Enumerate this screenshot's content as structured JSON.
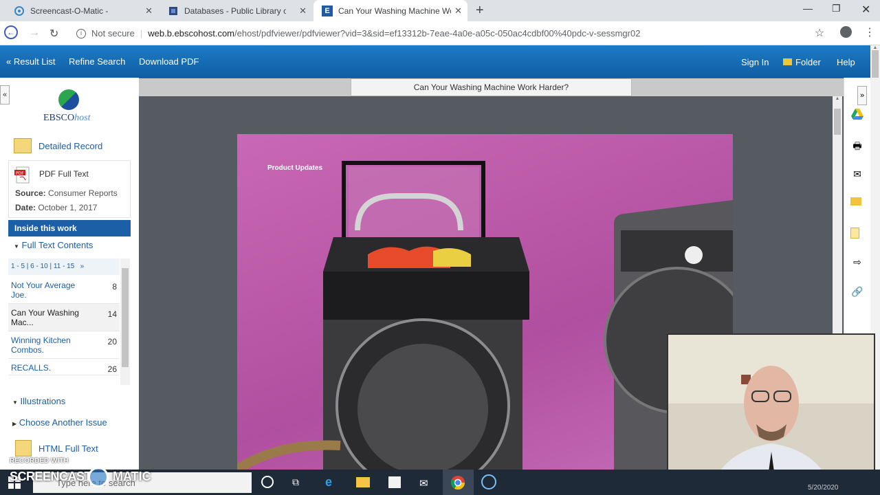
{
  "browser": {
    "tabs": [
      {
        "title": "Screencast-O-Matic -",
        "icon": "screencast-icon"
      },
      {
        "title": "Databases - Public Library of Ste",
        "icon": "library-icon"
      },
      {
        "title": "Can Your Washing Machine Work",
        "icon": "ebsco-e-icon"
      }
    ],
    "not_secure": "Not secure",
    "url_host": "web.b.ebscohost.com",
    "url_path": "/ehost/pdfviewer/pdfviewer?vid=3&sid=ef13312b-7eae-4a0e-a05c-050ac4cdbf00%40pdc-v-sessmgr02"
  },
  "ebsco_nav": {
    "result_list": "« Result List",
    "refine_search": "Refine Search",
    "download_pdf": "Download PDF",
    "sign_in": "Sign In",
    "folder": "Folder",
    "help": "Help"
  },
  "sidebar": {
    "logo_text_a": "EBSCO",
    "logo_text_b": "host",
    "detailed_record": "Detailed Record",
    "pdf_full_text": "PDF Full Text",
    "source_label": "Source:",
    "source_value": "Consumer Reports",
    "date_label": "Date:",
    "date_value": "October 1, 2017",
    "inside_this_work": "Inside this work",
    "full_text_contents": "Full Text Contents",
    "pager": [
      "1 - 5",
      "6 - 10",
      "11 - 15",
      "»"
    ],
    "toc": [
      {
        "title": "Not Your Average Joe.",
        "page": "8"
      },
      {
        "title": "Can Your Washing Mac...",
        "page": "14"
      },
      {
        "title": "Winning Kitchen Combos.",
        "page": "20"
      },
      {
        "title": "RECALLS.",
        "page": "26"
      }
    ],
    "illustrations": "Illustrations",
    "choose_another_issue": "Choose Another Issue",
    "html_full_text": "HTML Full Text"
  },
  "viewer": {
    "doc_title": "Can Your Washing Machine Work Harder?",
    "page_label": "Product Updates"
  },
  "watermark": {
    "line1": "RECORDED WITH",
    "line2": "SCREENCAST",
    "line3": "MATIC"
  },
  "taskbar": {
    "search_placeholder": "Type here to search",
    "clock": "5/20/2020"
  },
  "colors": {
    "ebsco_blue": "#1c5fa6",
    "viewer_bg": "#555b61",
    "page_magenta": "#c064b0"
  }
}
